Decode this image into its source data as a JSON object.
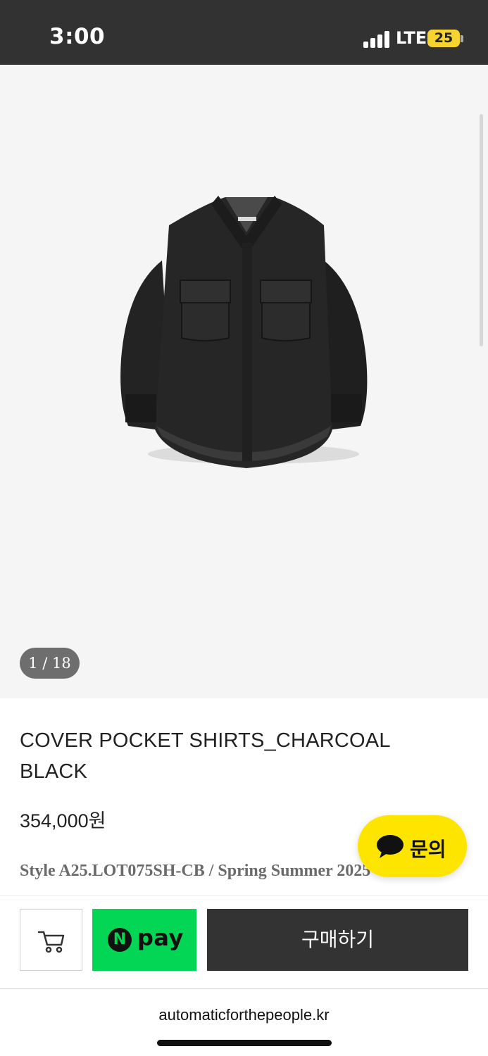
{
  "status_bar": {
    "time": "3:00",
    "network": "LTE",
    "battery": "25"
  },
  "gallery": {
    "counter": "1 / 18"
  },
  "product": {
    "title": "COVER POCKET SHIRTS_CHARCOAL BLACK",
    "price": "354,000원",
    "style_line": "Style A25.LOT075SH-CB / Spring Summer 2025"
  },
  "inquiry": {
    "label": "문의"
  },
  "actions": {
    "npay_label": "pay",
    "buy_label": "구매하기"
  },
  "browser": {
    "url": "automaticforthepeople.kr"
  },
  "icons": {
    "cart": "cart-icon",
    "chat": "chat-bubble-icon",
    "npay": "naver-pay-logo"
  },
  "colors": {
    "status_bar": "#323232",
    "npay_green": "#03d655",
    "kakao_yellow": "#fee500",
    "buy_button": "#333333"
  }
}
